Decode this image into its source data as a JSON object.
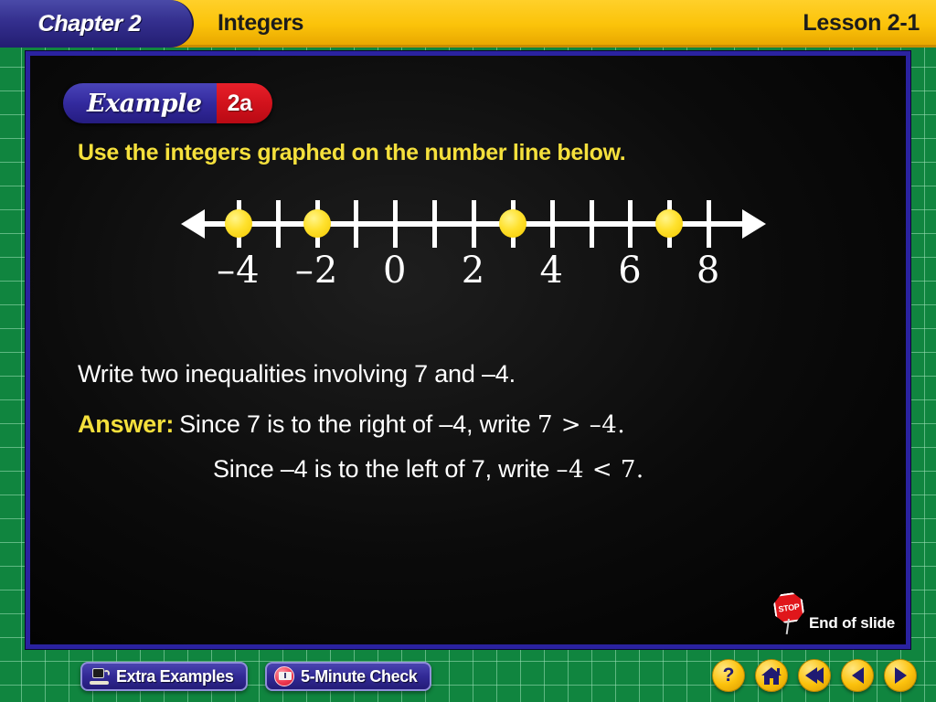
{
  "header": {
    "chapter": "Chapter 2",
    "topic": "Integers",
    "lesson": "Lesson 2-1"
  },
  "example": {
    "word": "Example",
    "number": "2a"
  },
  "content": {
    "prompt": "Use the integers graphed on the number line below.",
    "question": "Write two inequalities involving 7 and –4.",
    "answer_label": "Answer:",
    "answer_text_1": "Since 7 is to the right of –4, write",
    "answer_math_1": "7 > –4.",
    "answer_text_2": "Since –4 is to the left of 7, write",
    "answer_math_2": "–4 < 7."
  },
  "number_line": {
    "min": -5,
    "max": 9,
    "ticks": [
      -4,
      -3,
      -2,
      -1,
      0,
      1,
      2,
      3,
      4,
      5,
      6,
      7,
      8
    ],
    "labels": [
      {
        "value": -4,
        "text": "–4"
      },
      {
        "value": -2,
        "text": "–2"
      },
      {
        "value": 0,
        "text": "0"
      },
      {
        "value": 2,
        "text": "2"
      },
      {
        "value": 4,
        "text": "4"
      },
      {
        "value": 6,
        "text": "6"
      },
      {
        "value": 8,
        "text": "8"
      }
    ],
    "graphed_points": [
      -4,
      -2,
      3,
      7
    ],
    "left_arrow": "arrow-left",
    "right_arrow": "arrow-right",
    "dot_color": "#ffe12e",
    "line_color": "#ffffff"
  },
  "end_of_slide": {
    "label": "End of slide",
    "icon": "stop-sign",
    "stop_text": "STOP"
  },
  "footer": {
    "extra_examples": "Extra Examples",
    "five_minute_check": "5-Minute Check",
    "nav": {
      "help": "?",
      "home": "home-icon",
      "rewind": "rewind-icon",
      "back": "back-icon",
      "next": "next-icon"
    }
  },
  "colors": {
    "header_yellow": "#fbc30a",
    "navy": "#2a22a0",
    "grid_green": "#10853f",
    "accent_yellow": "#f5e03c",
    "badge_red": "#d2121c"
  }
}
